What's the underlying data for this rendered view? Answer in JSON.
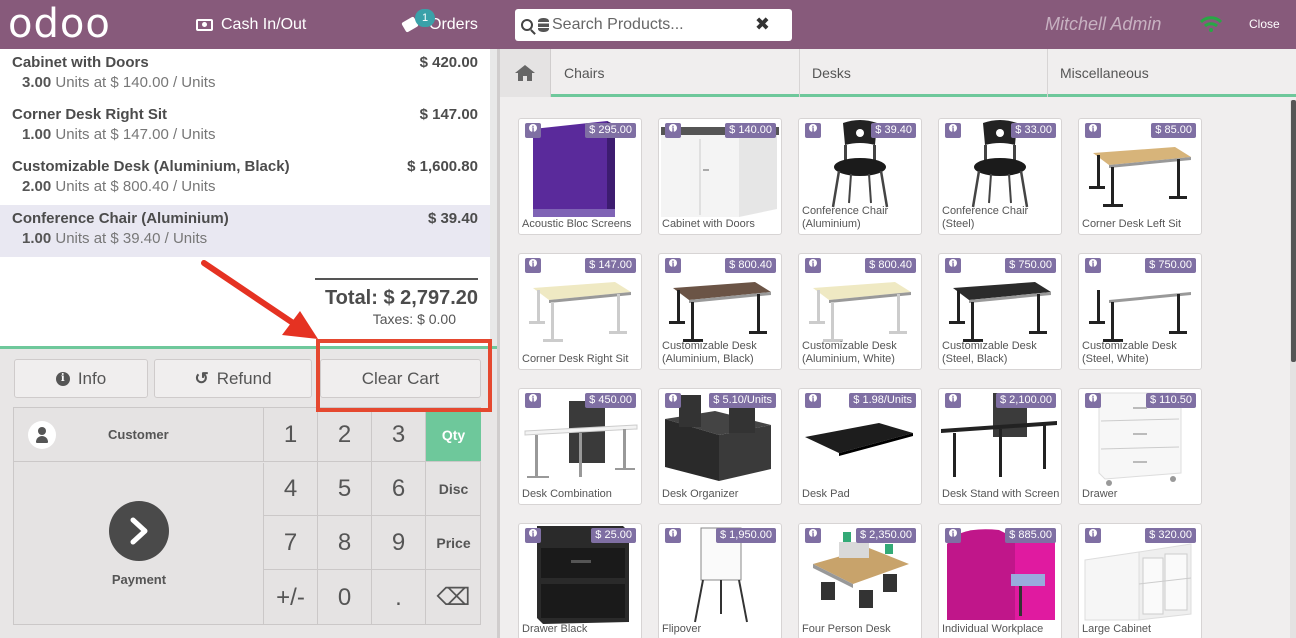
{
  "header": {
    "logo": "odoo",
    "cash_label": "Cash In/Out",
    "orders_label": "Orders",
    "orders_count": "1",
    "search_placeholder": "Search Products...",
    "clear_symbol": "✖",
    "user": "Mitchell Admin",
    "close_label": "Close"
  },
  "orderlines": [
    {
      "name": "Cabinet with Doors",
      "price": "$ 420.00",
      "qty": "3.00",
      "detail": "Units at $ 140.00 / Units",
      "selected": false
    },
    {
      "name": "Corner Desk Right Sit",
      "price": "$ 147.00",
      "qty": "1.00",
      "detail": "Units at $ 147.00 / Units",
      "selected": false
    },
    {
      "name": "Customizable Desk (Aluminium, Black)",
      "price": "$ 1,600.80",
      "qty": "2.00",
      "detail": "Units at $ 800.40 / Units",
      "selected": false
    },
    {
      "name": "Conference Chair (Aluminium)",
      "price": "$ 39.40",
      "qty": "1.00",
      "detail": "Units at $ 39.40 / Units",
      "selected": true
    }
  ],
  "summary": {
    "total": "Total: $ 2,797.20",
    "taxes": "Taxes: $ 0.00"
  },
  "actions": {
    "info": "Info",
    "refund": "Refund",
    "clear_cart": "Clear Cart"
  },
  "pad": {
    "customer": "Customer",
    "payment": "Payment",
    "keys": [
      "1",
      "2",
      "3",
      "Qty",
      "4",
      "5",
      "6",
      "Disc",
      "7",
      "8",
      "9",
      "Price",
      "+/-",
      "0",
      ".",
      "⌫"
    ],
    "active_mode": "Qty"
  },
  "categories": [
    "Chairs",
    "Desks",
    "Miscellaneous"
  ],
  "products": [
    {
      "name": "Acoustic Bloc Screens",
      "price": "$ 295.00",
      "img": "screen-purple"
    },
    {
      "name": "Cabinet with Doors",
      "price": "$ 140.00",
      "img": "cabinet-white"
    },
    {
      "name": "Conference Chair (Aluminium)",
      "price": "$ 39.40",
      "img": "chair"
    },
    {
      "name": "Conference Chair (Steel)",
      "price": "$ 33.00",
      "img": "chair"
    },
    {
      "name": "Corner Desk Left Sit",
      "price": "$ 85.00",
      "img": "desk-wood"
    },
    {
      "name": "Corner Desk Right Sit",
      "price": "$ 147.00",
      "img": "desk-cream"
    },
    {
      "name": "Customizable Desk (Aluminium, Black)",
      "price": "$ 800.40",
      "img": "desk-dark"
    },
    {
      "name": "Customizable Desk (Aluminium, White)",
      "price": "$ 800.40",
      "img": "desk-cream"
    },
    {
      "name": "Customizable Desk (Steel, Black)",
      "price": "$ 750.00",
      "img": "desk-black"
    },
    {
      "name": "Customizable Desk (Steel, White)",
      "price": "$ 750.00",
      "img": "desk-white"
    },
    {
      "name": "Desk Combination",
      "price": "$ 450.00",
      "img": "desk-combo"
    },
    {
      "name": "Desk Organizer",
      "price": "$ 5.10/Units",
      "img": "organizer"
    },
    {
      "name": "Desk Pad",
      "price": "$ 1.98/Units",
      "img": "desk-pad"
    },
    {
      "name": "Desk Stand with Screen",
      "price": "$ 2,100.00",
      "img": "desk-stand"
    },
    {
      "name": "Drawer",
      "price": "$ 110.50",
      "img": "drawer-white"
    },
    {
      "name": "Drawer Black",
      "price": "$ 25.00",
      "img": "drawer-black"
    },
    {
      "name": "Flipover",
      "price": "$ 1,950.00",
      "img": "flipover"
    },
    {
      "name": "Four Person Desk",
      "price": "$ 2,350.00",
      "img": "four-desk"
    },
    {
      "name": "Individual Workplace",
      "price": "$ 885.00",
      "img": "workplace-pink"
    },
    {
      "name": "Large Cabinet",
      "price": "$ 320.00",
      "img": "large-cabinet"
    }
  ],
  "colors": {
    "brand": "#875a7b",
    "accent": "#6ec89b",
    "badge": "#7f6fa3",
    "highlight": "#e5482f"
  }
}
